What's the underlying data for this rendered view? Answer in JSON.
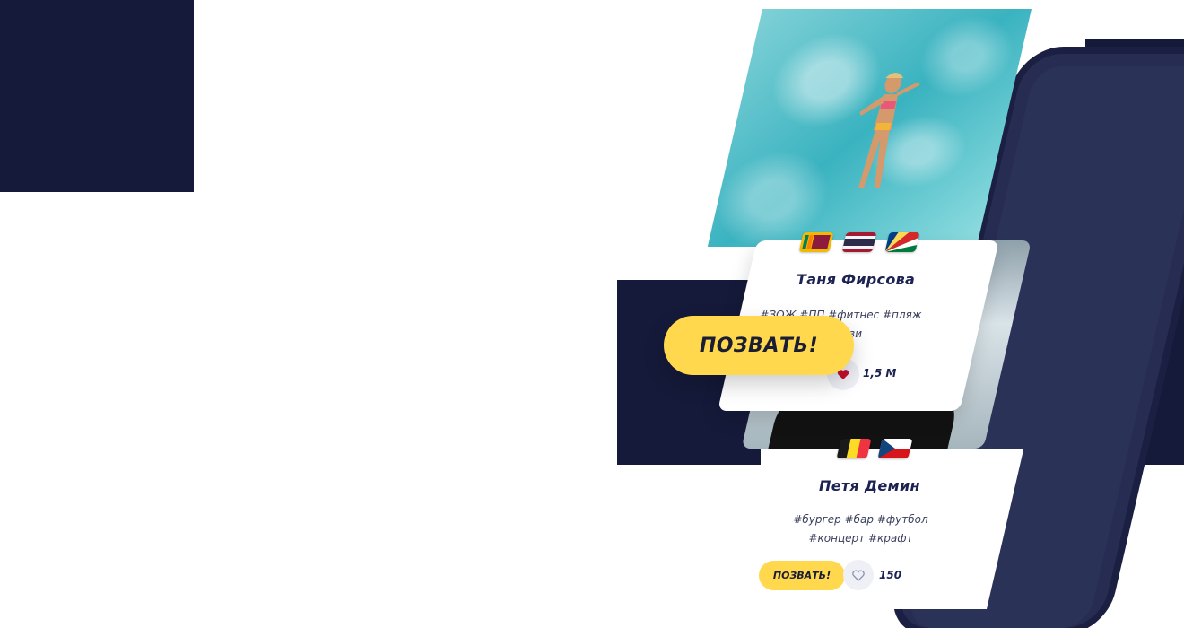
{
  "colors": {
    "navy": "#151a3a",
    "accent": "#ffd84d",
    "heart_red": "#c8102e",
    "text_dark": "#1c2352"
  },
  "cards": [
    {
      "name": "Таня Фирсова",
      "tags_line1": "#ЗОЖ #ПП #фитнес #пляж",
      "tags_line2": "#смузи",
      "likes": "1,5 М",
      "liked": true,
      "flags": [
        "sri-lanka-flag",
        "thailand-flag",
        "seychelles-flag"
      ],
      "button_label": "ПОЗВАТЬ!"
    },
    {
      "name": "Петя Демин",
      "tags_line1": "#бургер #бар #футбол",
      "tags_line2": "#концерт #крафт",
      "likes": "150",
      "liked": false,
      "flags": [
        "belgium-flag",
        "czech-flag"
      ],
      "button_label": "ПОЗВАТЬ!"
    }
  ]
}
